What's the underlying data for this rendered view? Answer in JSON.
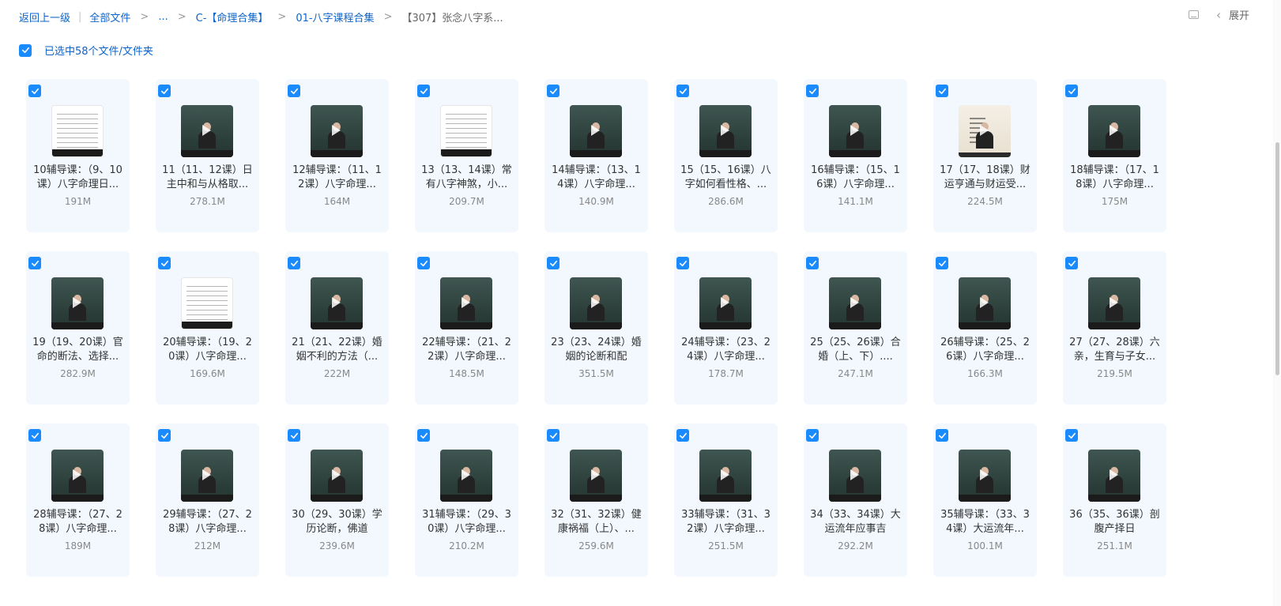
{
  "breadcrumb": {
    "back": "返回上一级",
    "all_files": "全部文件",
    "ellipsis": "...",
    "level1": "C-【命理合集】",
    "level2": "01-八字课程合集",
    "current": "【307】张念八字系..."
  },
  "top_right": {
    "expand_label": "展开"
  },
  "selection": {
    "text": "已选中58个文件/文件夹"
  },
  "colors": {
    "accent": "#1a8bff",
    "link": "#0d63c9",
    "card_bg": "#f2f8fe"
  },
  "files": [
    {
      "name": "10辅导课：（9、10课）八字命理日...",
      "size": "191M",
      "thumb": "doc"
    },
    {
      "name": "11（11、12课）日主中和与从格取...",
      "size": "278.1M",
      "thumb": "video"
    },
    {
      "name": "12辅导课：（11、12课）八字命理...",
      "size": "164M",
      "thumb": "video"
    },
    {
      "name": "13（13、14课）常有八字神煞，小...",
      "size": "209.7M",
      "thumb": "doc"
    },
    {
      "name": "14辅导课：（13、14课）八字命理...",
      "size": "140.9M",
      "thumb": "video"
    },
    {
      "name": "15（15、16课）八字如何看性格、...",
      "size": "286.6M",
      "thumb": "video"
    },
    {
      "name": "16辅导课：（15、16课）八字命理...",
      "size": "141.1M",
      "thumb": "video"
    },
    {
      "name": "17（17、18课）财运亨通与财运受...",
      "size": "224.5M",
      "thumb": "slide"
    },
    {
      "name": "18辅导课：（17、18课）八字命理...",
      "size": "175M",
      "thumb": "video"
    },
    {
      "name": "19（19、20课）官命的断法、选择...",
      "size": "282.9M",
      "thumb": "video"
    },
    {
      "name": "20辅导课：（19、20课）八字命理...",
      "size": "169.6M",
      "thumb": "doc"
    },
    {
      "name": "21（21、22课）婚姻不利的方法（...",
      "size": "222M",
      "thumb": "video"
    },
    {
      "name": "22辅导课：（21、22课）八字命理...",
      "size": "148.5M",
      "thumb": "video"
    },
    {
      "name": "23（23、24课）婚姻的论断和配",
      "size": "351.5M",
      "thumb": "video"
    },
    {
      "name": "24辅导课：（23、24课）八字命理...",
      "size": "178.7M",
      "thumb": "video"
    },
    {
      "name": "25（25、26课）合婚（上、下）....",
      "size": "247.1M",
      "thumb": "video"
    },
    {
      "name": "26辅导课：（25、26课）八字命理...",
      "size": "166.3M",
      "thumb": "video"
    },
    {
      "name": "27（27、28课）六亲，生育与子女...",
      "size": "219.5M",
      "thumb": "video"
    },
    {
      "name": "28辅导课：（27、28课）八字命理...",
      "size": "189M",
      "thumb": "video"
    },
    {
      "name": "29辅导课：（27、28课）八字命理...",
      "size": "212M",
      "thumb": "video"
    },
    {
      "name": "30（29、30课）学历论断，佛道",
      "size": "239.6M",
      "thumb": "video"
    },
    {
      "name": "31辅导课：（29、30课）八字命理...",
      "size": "210.2M",
      "thumb": "video"
    },
    {
      "name": "32（31、32课）健康祸福（上）、...",
      "size": "259.6M",
      "thumb": "video"
    },
    {
      "name": "33辅导课：（31、32课）八字命理...",
      "size": "251.5M",
      "thumb": "video"
    },
    {
      "name": "34（33、34课）大运流年应事吉",
      "size": "292.2M",
      "thumb": "video"
    },
    {
      "name": "35辅导课：（33、34课）大运流年...",
      "size": "100.1M",
      "thumb": "video"
    },
    {
      "name": "36（35、36课）剖腹产择日",
      "size": "251.1M",
      "thumb": "video"
    }
  ]
}
